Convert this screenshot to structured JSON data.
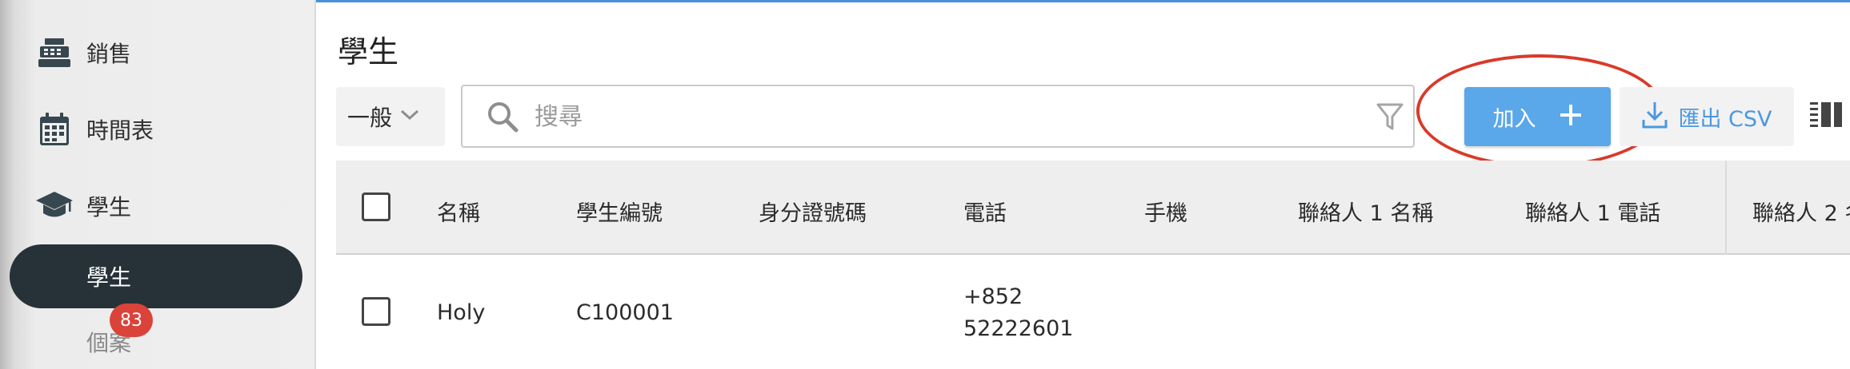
{
  "sidebar": {
    "items": [
      {
        "label": "銷售",
        "icon": "cash-register-icon"
      },
      {
        "label": "時間表",
        "icon": "calendar-icon"
      },
      {
        "label": "學生",
        "icon": "graduation-cap-icon"
      }
    ],
    "active_sub": "學生",
    "next_sub": "個案",
    "badge_count": "83"
  },
  "main": {
    "title": "學生",
    "scope_select": {
      "value": "一般",
      "icon": "chevron-down-icon"
    },
    "search": {
      "placeholder": "搜尋",
      "value": "",
      "icon": "search-icon",
      "filter_icon": "filter-icon"
    },
    "add_button": {
      "label": "加入",
      "icon": "plus-icon"
    },
    "export_button": {
      "label": "匯出 CSV",
      "icon": "download-icon"
    },
    "columns_icon": "columns-icon"
  },
  "table": {
    "headers": [
      "名稱",
      "學生編號",
      "身分證號碼",
      "電話",
      "手機",
      "聯絡人 1 名稱",
      "聯絡人 1 電話",
      "聯絡人 2 名"
    ],
    "rows": [
      {
        "name": "Holy",
        "student_id": "C100001",
        "id_number": "",
        "phone_line1": "+852",
        "phone_line2": "52222601",
        "mobile": "",
        "contact1_name": "",
        "contact1_phone": "",
        "contact2_name": ""
      }
    ]
  },
  "colors": {
    "sidebar_active": "#263238",
    "primary": "#5aa7ea",
    "badge": "#d9433a",
    "highlight_circle": "#d83a2a",
    "export_text": "#4a98e0"
  }
}
